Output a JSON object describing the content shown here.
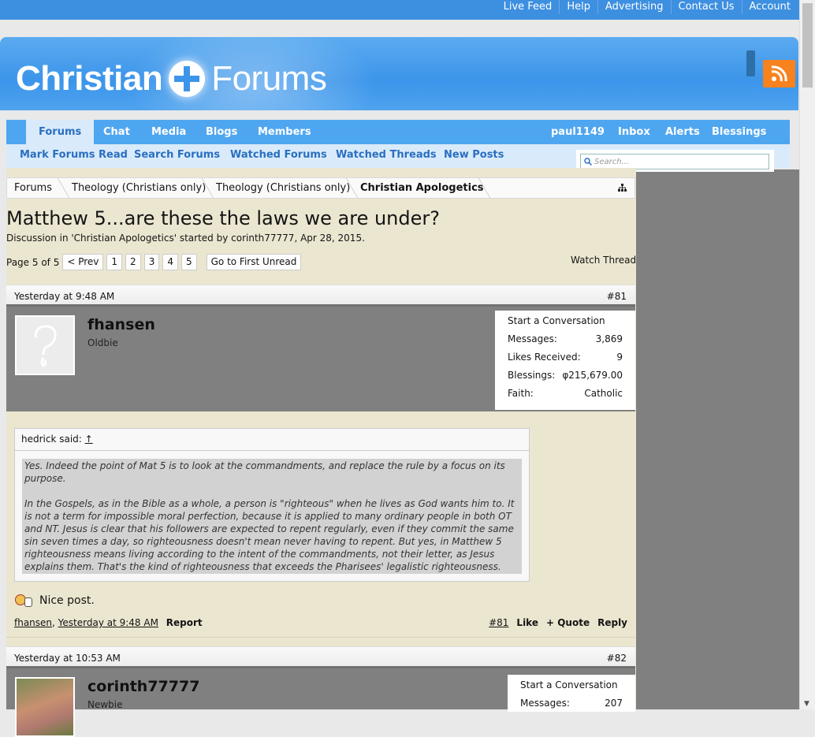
{
  "topbar": {
    "links": [
      "Live Feed",
      "Help",
      "Advertising",
      "Contact Us",
      "Account"
    ]
  },
  "header": {
    "logo_part1": "Christian",
    "logo_part2": "Forums"
  },
  "nav": {
    "tabs": [
      "Forums",
      "Chat",
      "Media",
      "Blogs",
      "Members"
    ],
    "user": "paul1149",
    "right": [
      "Inbox",
      "Alerts",
      "Blessings"
    ]
  },
  "subnav": [
    "Mark Forums Read",
    "Search Forums",
    "Watched Forums",
    "Watched Threads",
    "New Posts"
  ],
  "search": {
    "placeholder": "Search..."
  },
  "breadcrumb": [
    "Forums",
    "Theology (Christians only)",
    "Theology (Christians only)",
    "Christian Apologetics"
  ],
  "thread": {
    "title": "Matthew 5...are these the laws we are under?",
    "subtitle": "Discussion in 'Christian Apologetics' started by corinth77777, Apr 28, 2015.",
    "page_label": "Page 5 of 5",
    "prev": "< Prev",
    "pages": [
      "1",
      "2",
      "3",
      "4",
      "5"
    ],
    "first_unread": "Go to First Unread",
    "watch": "Watch Thread"
  },
  "post81": {
    "date": "Yesterday at 9:48 AM",
    "number": "#81",
    "user": "fhansen",
    "user_title": "Oldbie",
    "stats": {
      "start": "Start a Conversation",
      "rows": [
        {
          "label": "Messages:",
          "value": "3,869"
        },
        {
          "label": "Likes Received:",
          "value": "9"
        },
        {
          "label": "Blessings:",
          "value": "φ215,679.00"
        },
        {
          "label": "Faith:",
          "value": "Catholic"
        }
      ]
    },
    "quote": {
      "author": "hedrick said:",
      "arrow": "↑",
      "p1": "Yes. Indeed the point of Mat 5 is to look at the commandments, and replace the rule by a focus on its purpose.",
      "p2": "In the Gospels, as in the Bible as a whole, a person is \"righteous\" when he lives as God wants him to. It is not a term for impossible moral perfection, because it is applied to many ordinary people in both OT and NT. Jesus is clear that his followers are expected to repent regularly, even if they commit the same sin seven times a day, so righteousness doesn't mean never having to repent. But yes, in Matthew 5 righteousness means living according to the intent of the commandments, not their letter, as Jesus explains them. That's the kind of righteousness that exceeds the Pharisees' legalistic righteousness."
    },
    "reply": "Nice post.",
    "footer": {
      "user": "fhansen",
      "date": "Yesterday at 9:48 AM",
      "report": "Report",
      "number": "#81",
      "like": "Like",
      "quote": "+ Quote",
      "reply": "Reply"
    }
  },
  "post82": {
    "date": "Yesterday at 10:53 AM",
    "number": "#82",
    "user": "corinth77777",
    "user_title": "Newbie",
    "stats": {
      "start": "Start a Conversation",
      "rows": [
        {
          "label": "Messages:",
          "value": "207"
        }
      ]
    }
  }
}
